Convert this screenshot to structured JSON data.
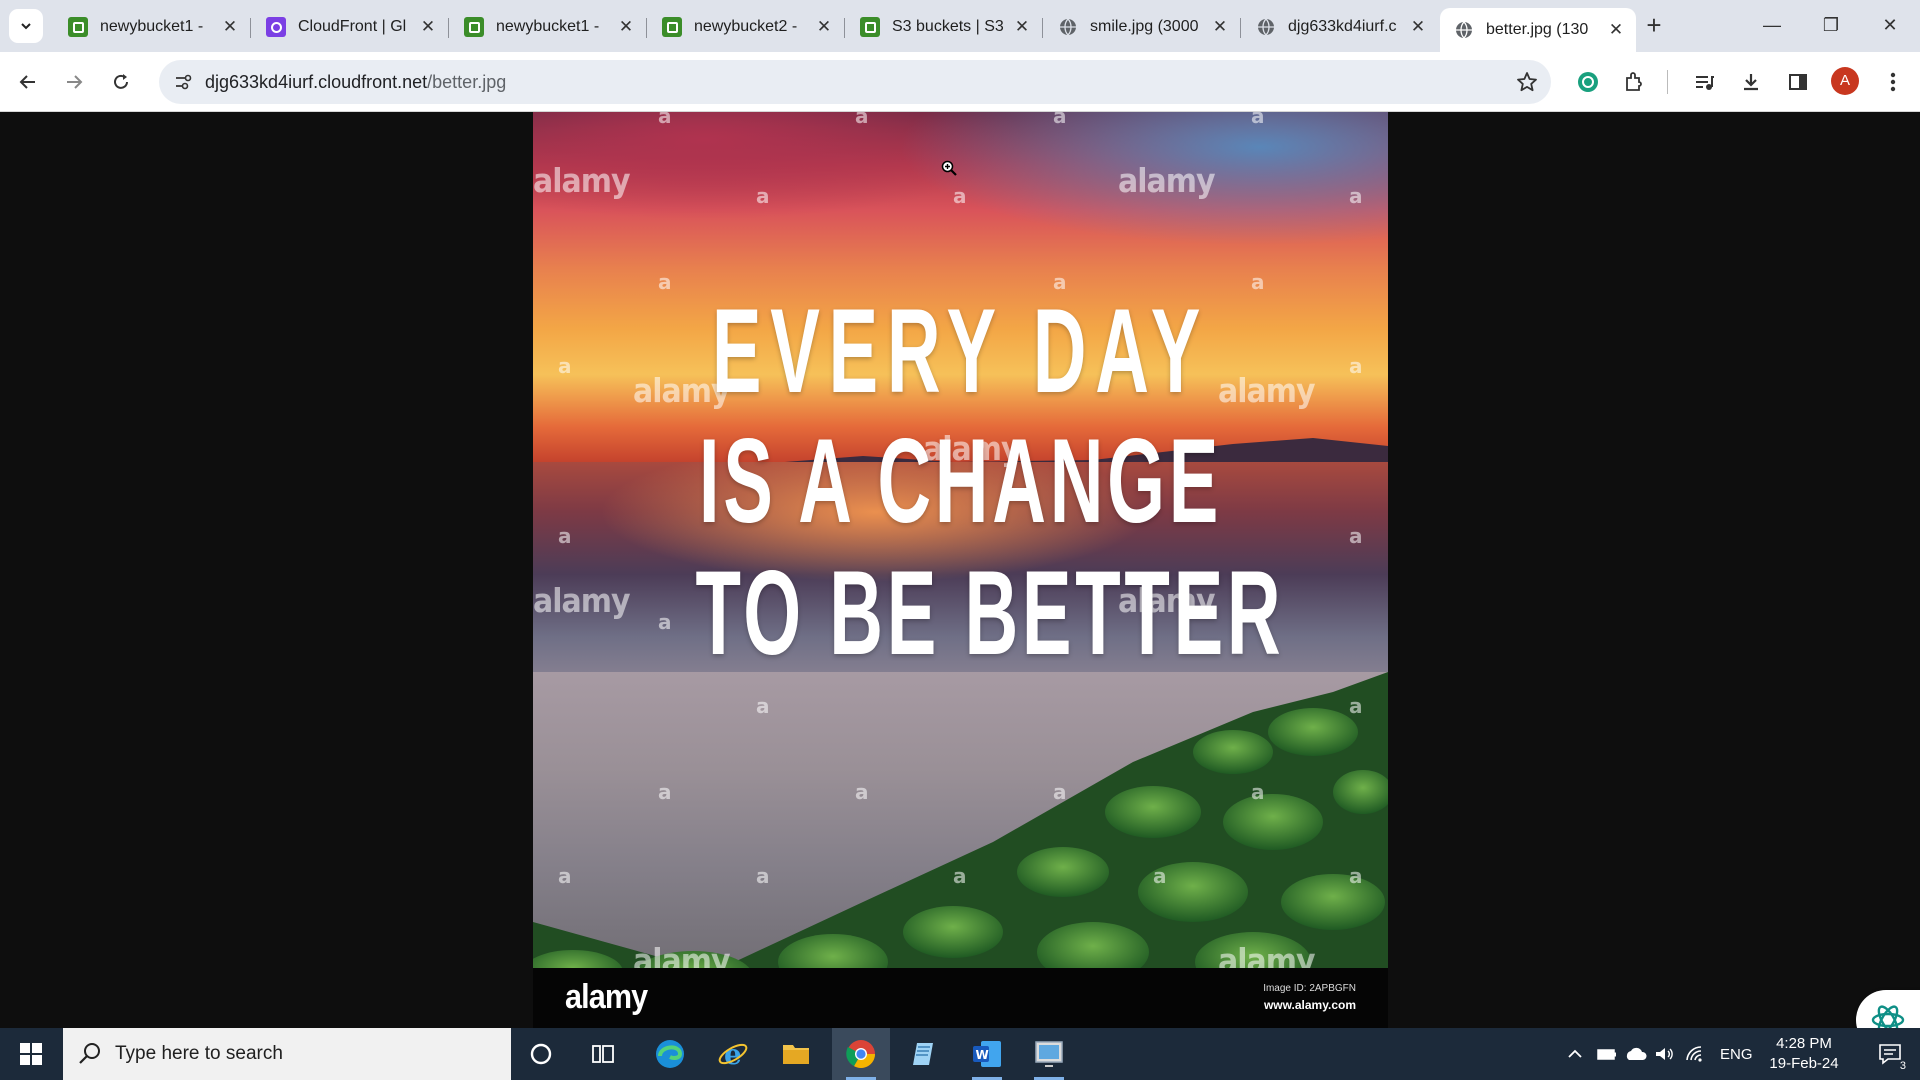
{
  "tabs": [
    {
      "title": "newybucket1 -",
      "favicon": "s3-icon"
    },
    {
      "title": "CloudFront | Gl",
      "favicon": "cloudfront-icon"
    },
    {
      "title": "newybucket1 -",
      "favicon": "s3-icon"
    },
    {
      "title": "newybucket2 -",
      "favicon": "s3-icon"
    },
    {
      "title": "S3 buckets | S3",
      "favicon": "s3-icon"
    },
    {
      "title": "smile.jpg (3000",
      "favicon": "globe-icon"
    },
    {
      "title": "djg633kd4iurf.c",
      "favicon": "globe-icon"
    },
    {
      "title": "better.jpg (130",
      "favicon": "globe-icon",
      "active": true
    }
  ],
  "address_bar": {
    "host": "djg633kd4iurf.cloudfront.net",
    "path": "/better.jpg"
  },
  "profile_initial": "A",
  "image": {
    "quote_lines": [
      "EVERY DAY",
      "IS A CHANGE",
      "TO BE BETTER"
    ],
    "watermark_word": "alamy",
    "watermark_letter": "a",
    "footer_brand": "alamy",
    "footer_image_id": "Image ID: 2APBGFN",
    "footer_site": "www.alamy.com"
  },
  "taskbar": {
    "search_placeholder": "Type here to search",
    "apps": [
      "cortana-icon",
      "task-view-icon",
      "edge-icon",
      "internet-explorer-icon",
      "file-explorer-icon",
      "chrome-icon",
      "notepad-icon",
      "word-icon",
      "remote-desktop-icon"
    ],
    "language": "ENG",
    "time": "4:28 PM",
    "date": "19-Feb-24",
    "notification_count": "3"
  },
  "colors": {
    "tabstrip": "#dfe3eb",
    "taskbar": "#1c2a3a",
    "s3_favicon": "#3b8d29",
    "cloudfront_favicon": "#7b3fe4",
    "profile_avatar": "#c8371f"
  }
}
